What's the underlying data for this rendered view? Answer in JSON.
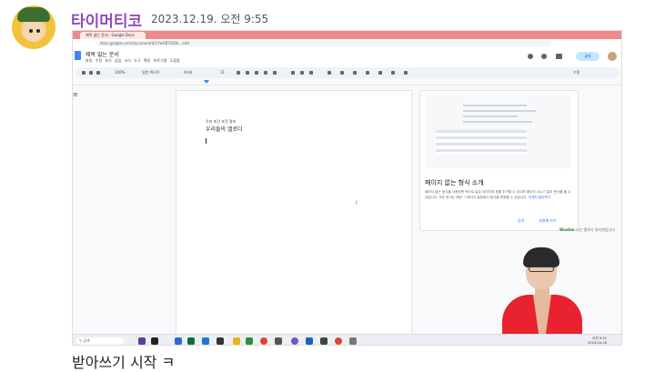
{
  "post": {
    "author": "타이머티코",
    "timestamp": "2023.12.19. 오전 9:55",
    "message": "받아쓰기 시작 ㅋ"
  },
  "screenshot": {
    "browser_tab": "제목 없는 문서 - Google Docs",
    "url": "docs.google.com/document/d/1YwXBTlOQk...edit",
    "doc_title": "제목 없는 문서",
    "menu": [
      "파일",
      "수정",
      "보기",
      "삽입",
      "서식",
      "도구",
      "확장 프로그램",
      "도움말"
    ],
    "share_label": "공유",
    "toolbar": {
      "zoom": "100%",
      "style": "일반 텍스트",
      "font": "Arial",
      "size": "11",
      "mode": "수정"
    },
    "page": {
      "small_line": "우리 조건 조건 정보",
      "big_line": "우리들의 엘로디"
    },
    "panel": {
      "title": "페이지 없는 형식 소개",
      "description": "페이지 없는 형식을 사용하면 텍스트 넓은 이미지와 표를 추가할 수 있으며 페이지 나누기 없이 문서를 볼 수 있습니다. 모든 문서는 해당 → 페이지 설정에서 형식을 변경할 수 있습니다.",
      "link": "자세히 알아보기",
      "button_close": "닫기",
      "button_use": "사용해 보기"
    },
    "chat": {
      "user": "Woalim",
      "text": "나는 엘로디 뮤지션입니다"
    },
    "taskbar": {
      "search": "검색",
      "time": "오전 9:52",
      "date": "2023-04-16"
    }
  },
  "colors": {
    "author": "#8e4fb8",
    "browser_bar": "#f08a8a",
    "share": "#c2e7ff",
    "shirt": "#e8232f"
  }
}
